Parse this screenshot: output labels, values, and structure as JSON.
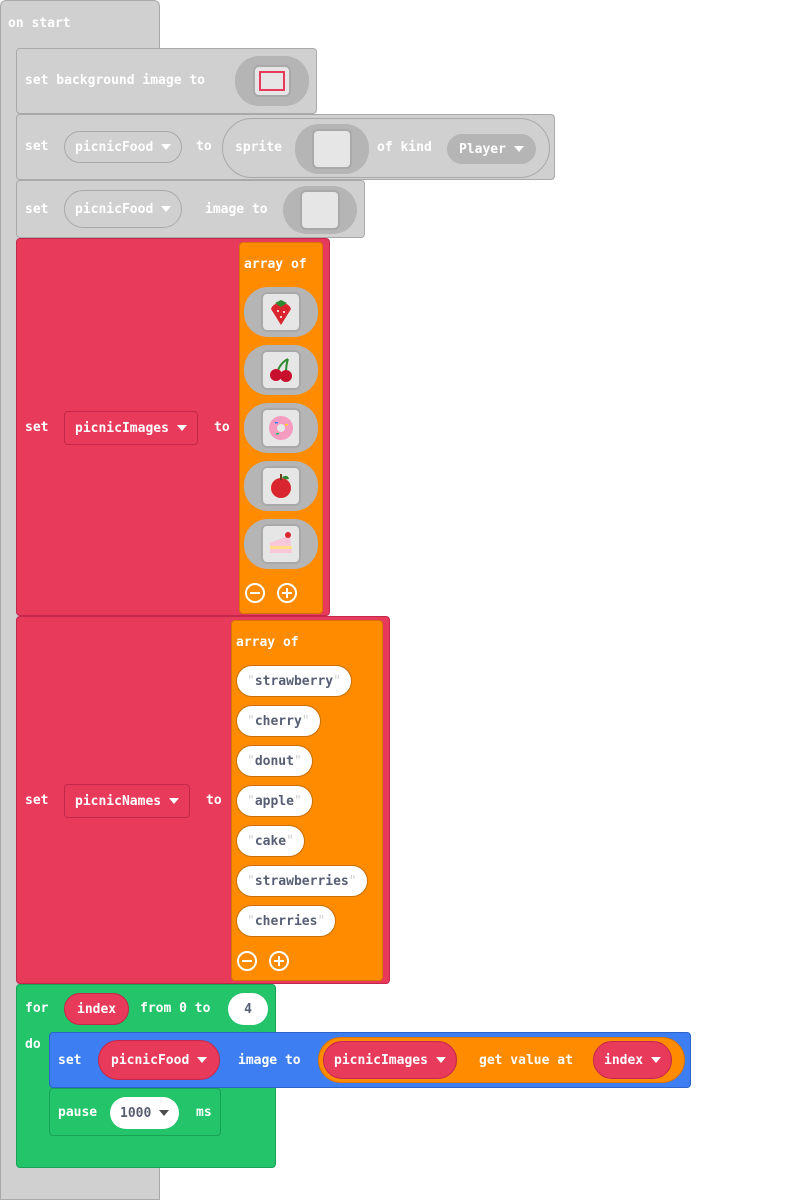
{
  "event": {
    "label": "on start"
  },
  "bg_block": {
    "set": "set",
    "text": "set background image to"
  },
  "sprite_block": {
    "set": "set",
    "variable": "picnicFood",
    "to": "to",
    "sprite_label": "sprite",
    "of_kind": "of kind",
    "kind": "Player"
  },
  "image_block": {
    "set": "set",
    "variable": "picnicFood",
    "image_to": "image to"
  },
  "images_block": {
    "set": "set",
    "variable": "picnicImages",
    "to": "to",
    "array_label": "array of",
    "images": [
      "strawberry-image-icon",
      "cherry-image-icon",
      "donut-image-icon",
      "apple-image-icon",
      "cake-image-icon"
    ]
  },
  "names_block": {
    "set": "set",
    "variable": "picnicNames",
    "to": "to",
    "array_label": "array of",
    "items": [
      "strawberry",
      "cherry",
      "donut",
      "apple",
      "cake",
      "strawberries",
      "cherries"
    ]
  },
  "for_block": {
    "for": "for",
    "variable": "index",
    "from_text": "from 0 to",
    "end": "4",
    "do": "do"
  },
  "inner_set": {
    "set": "set",
    "variable": "picnicFood",
    "image_to": "image to",
    "array_var": "picnicImages",
    "get_value_at": "get value at",
    "index_var": "index"
  },
  "pause_block": {
    "pause": "pause",
    "value": "1000",
    "unit": "ms"
  },
  "colors": {
    "sprites": "#d0d0d0",
    "variables": "#e83a5a",
    "arrays": "#ff8b00",
    "loops": "#23c46a",
    "sprite_ops": "#3d7ff2"
  }
}
